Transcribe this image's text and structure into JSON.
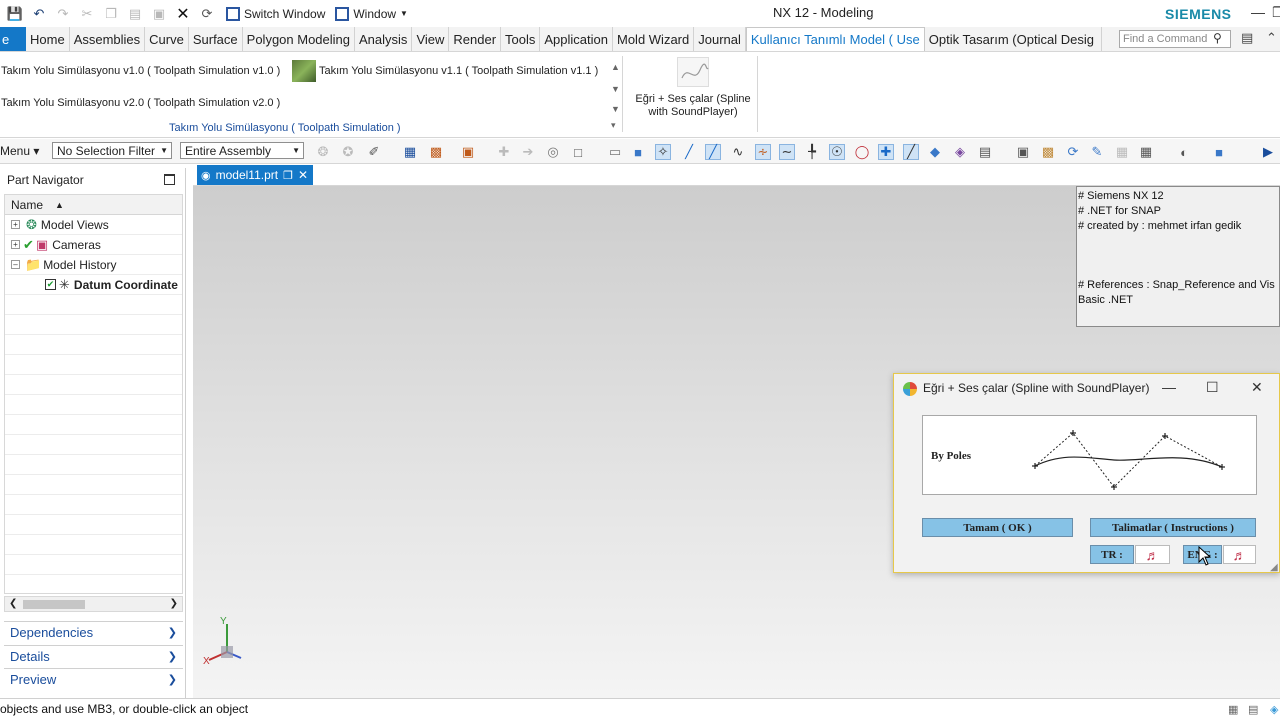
{
  "titlebar": {
    "switch_window": "Switch Window",
    "window_menu": "Window",
    "title": "NX 12 - Modeling",
    "brand": "SIEMENS"
  },
  "tabs": [
    {
      "label": "Home"
    },
    {
      "label": "Assemblies"
    },
    {
      "label": "Curve"
    },
    {
      "label": "Surface"
    },
    {
      "label": "Polygon Modeling"
    },
    {
      "label": "Analysis"
    },
    {
      "label": "View"
    },
    {
      "label": "Render"
    },
    {
      "label": "Tools"
    },
    {
      "label": "Application"
    },
    {
      "label": "Mold Wizard"
    },
    {
      "label": "Journal"
    },
    {
      "label": "Kullanıcı Tanımlı Model ( Use"
    },
    {
      "label": "Optik Tasarım (Optical Desig"
    }
  ],
  "tab_file": "e",
  "command_finder": {
    "placeholder": "Find a Command"
  },
  "ribbon": {
    "items": [
      "Takım Yolu Simülasyonu v1.0 (  Toolpath Simulation v1.0 )",
      "Takım Yolu Simülasyonu v1.1 (  Toolpath Simulation v1.1 )",
      "Takım Yolu Simülasyonu v2.0 (  Toolpath Simulation v2.0 )"
    ],
    "group_label": "Takım Yolu Simülasyonu (  Toolpath Simulation )",
    "big_button_line1": "Eğri + Ses çalar (Spline",
    "big_button_line2": "with SoundPlayer)"
  },
  "selection": {
    "menu": "Menu",
    "filter": "No Selection Filter",
    "scope": "Entire Assembly"
  },
  "navigator": {
    "title": "Part Navigator",
    "column": "Name",
    "rows": [
      {
        "label": "Model Views"
      },
      {
        "label": "Cameras"
      },
      {
        "label": "Model History"
      },
      {
        "label": "Datum Coordinate"
      }
    ],
    "panels": [
      "Dependencies",
      "Details",
      "Preview"
    ]
  },
  "document": {
    "tab": "model11.prt"
  },
  "info_panel": {
    "line1": "# Siemens NX 12",
    "line2": "# .NET for SNAP",
    "line3": "# created by : mehmet irfan gedik",
    "line4": "# References : Snap_Reference and Vis",
    "line5": "Basic .NET"
  },
  "dialog": {
    "title": "Eğri + Ses çalar (Spline with SoundPlayer)",
    "group_label": "By Poles",
    "ok": "Tamam ( OK )",
    "instructions": "Talimatlar ( Instructions )",
    "tr": "TR :",
    "eng": "ENG :",
    "note_glyph": "♬"
  },
  "triad": {
    "x": "X",
    "y": "Y"
  },
  "status": "objects and use MB3, or double-click an object",
  "colors": {
    "accent": "#1478c8",
    "button": "#86c2e6",
    "brand": "#1a8aa8"
  }
}
